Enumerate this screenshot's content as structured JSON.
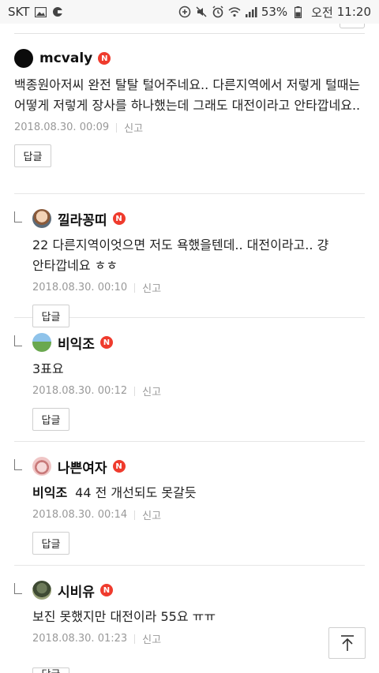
{
  "status_bar": {
    "carrier": "SKT",
    "battery": "53%",
    "ampm": "오전",
    "time": "11:20"
  },
  "labels": {
    "reply_button": "답글",
    "report": "신고",
    "new_badge": "N"
  },
  "comments": [
    {
      "nick": "mcvaly",
      "text": "백종원아저씨 완전 탈탈 털어주네요.. 다른지역에서 저렇게 털때는 어떻게 저렇게 장사를 하나했는데 그래도 대전이라고 안타깝네요..",
      "date": "2018.08.30. 00:09"
    },
    {
      "nick": "낄라꽁띠",
      "text": "22 다른지역이엇으면 저도 욕했을텐데.. 대전이라고.. 걍 안타깝네요 ㅎㅎ",
      "date": "2018.08.30. 00:10"
    },
    {
      "nick": "비익조",
      "text": "3표요",
      "date": "2018.08.30. 00:12"
    },
    {
      "nick": "나쁜여자",
      "mention": "비익조",
      "text": "44 전 개선되도 못갈듯",
      "date": "2018.08.30. 00:14"
    },
    {
      "nick": "시비유",
      "text": "보진 못했지만 대전이라 55요 ㅠㅠ",
      "date": "2018.08.30. 01:23"
    }
  ]
}
